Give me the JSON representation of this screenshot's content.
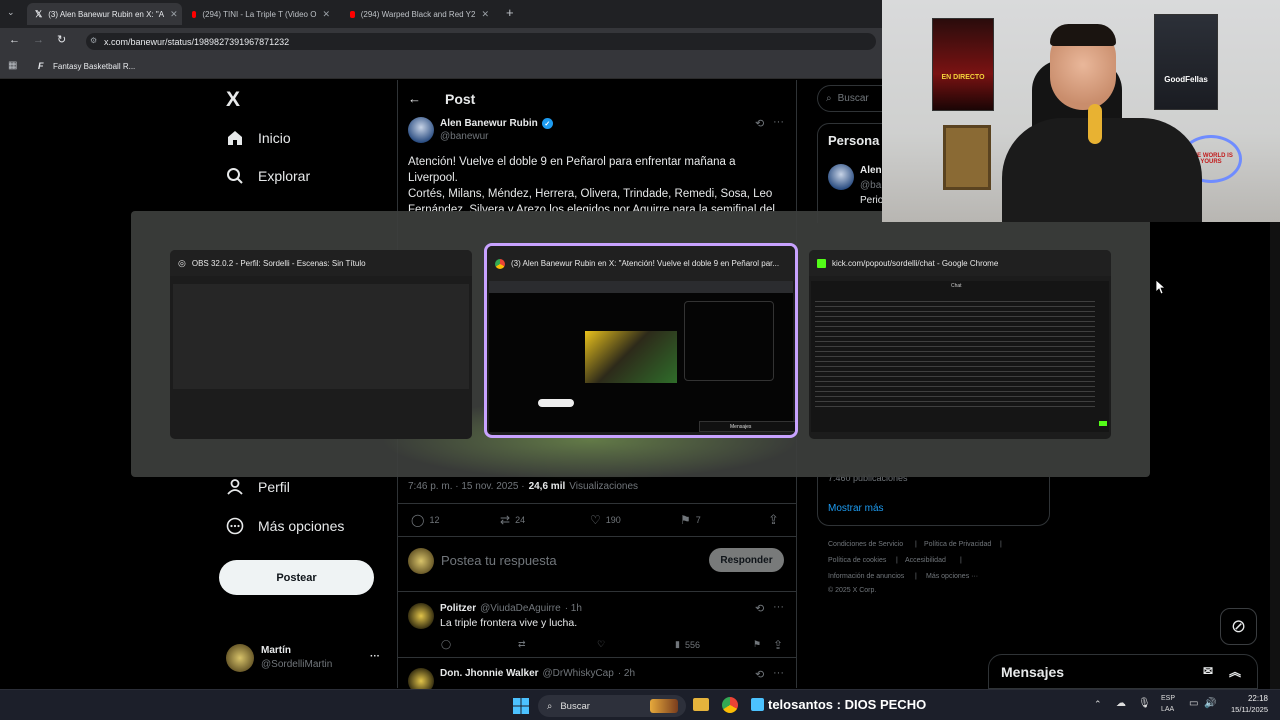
{
  "browser": {
    "tabs": [
      {
        "label": "(3) Alen Banewur Rubin en X: \"A"
      },
      {
        "label": "(294) TINI - La Triple T (Video O"
      },
      {
        "label": "(294) Warped Black and Red Y2"
      }
    ],
    "new_tab": "+",
    "url": "x.com/banewur/status/1989827391967871232",
    "bookmark": "Fantasy Basketball R..."
  },
  "sidebar": {
    "logo": "X",
    "items": [
      {
        "label": "Inicio",
        "icon": "home-icon"
      },
      {
        "label": "Explorar",
        "icon": "search-icon"
      },
      {
        "label": "Perfil",
        "icon": "profile-icon"
      },
      {
        "label": "Más opciones",
        "icon": "more-icon"
      }
    ],
    "post_button": "Postear",
    "user": {
      "name": "Martín",
      "handle": "@SordelliMartin",
      "menu": "···"
    }
  },
  "post": {
    "header": "Post",
    "author": "Alen Banewur Rubin",
    "handle": "@banewur",
    "text1": "Atención! Vuelve el doble 9 en Peñarol para enfrentar mañana a Liverpool.",
    "text2": "Cortés, Milans, Méndez, Herrera, Olivera, Trindade, Remedi, Sosa, Leo Fernández, Silvera y Arezo los elegidos por Aguirre para la semifinal del",
    "time": "7:46 p. m. · 15 nov. 2025 ·",
    "views": "24,6 mil",
    "views_label": "Visualizaciones",
    "stats": {
      "replies": "12",
      "reposts": "24",
      "likes": "190",
      "bookmarks": "7"
    },
    "reply_placeholder": "Postea tu respuesta",
    "reply_button": "Responder"
  },
  "replies": [
    {
      "name": "Politzer",
      "handle": "@ViudaDeAguirre",
      "time": "· 1h",
      "text": "La triple frontera vive y lucha.",
      "views": "556"
    },
    {
      "name": "Don. Jhonnie Walker",
      "handle": "@DrWhiskyCap",
      "time": "· 2h"
    }
  ],
  "right": {
    "search_placeholder": "Buscar",
    "section_title": "Persona",
    "person_name": "Alen",
    "person_handle": "@ba",
    "person_bio": "Perio",
    "count": "7.460 publicaciones",
    "show_more": "Mostrar más",
    "footer": [
      "Condiciones de Servicio",
      "|",
      "Política de Privacidad",
      "|",
      "Política de cookies",
      "|",
      "Accesibilidad",
      "|",
      "Información de anuncios",
      "|",
      "Más opciones ···",
      "© 2025 X Corp."
    ]
  },
  "switcher": {
    "windows": [
      {
        "title": "OBS 32.0.2 - Perfil: Sordelli - Escenas: Sin Título"
      },
      {
        "title": "(3) Alen Banewur Rubin en X: \"Atención! Vuelve el doble 9 en Peñarol par..."
      },
      {
        "title": "kick.com/popout/sordelli/chat - Google Chrome"
      }
    ],
    "thumb2_bar": "Mensajes",
    "thumb3_header": "Chat"
  },
  "messages": {
    "title": "Mensajes"
  },
  "webcam": {
    "poster_left": "EN DIRECTO",
    "poster_right": "GoodFellas",
    "sign": "THE WORLD IS YOURS"
  },
  "taskbar": {
    "search": "Buscar",
    "stream_text": "telosantos : DIOS PECHO",
    "lang1": "ESP",
    "lang2": "LAA",
    "time": "22:18",
    "date": "15/11/2025"
  },
  "colors": {
    "accent": "#1d9bf0",
    "bg": "#000000",
    "border": "#2f3336",
    "muted": "#71767b",
    "selected": "#c8a2ff"
  }
}
